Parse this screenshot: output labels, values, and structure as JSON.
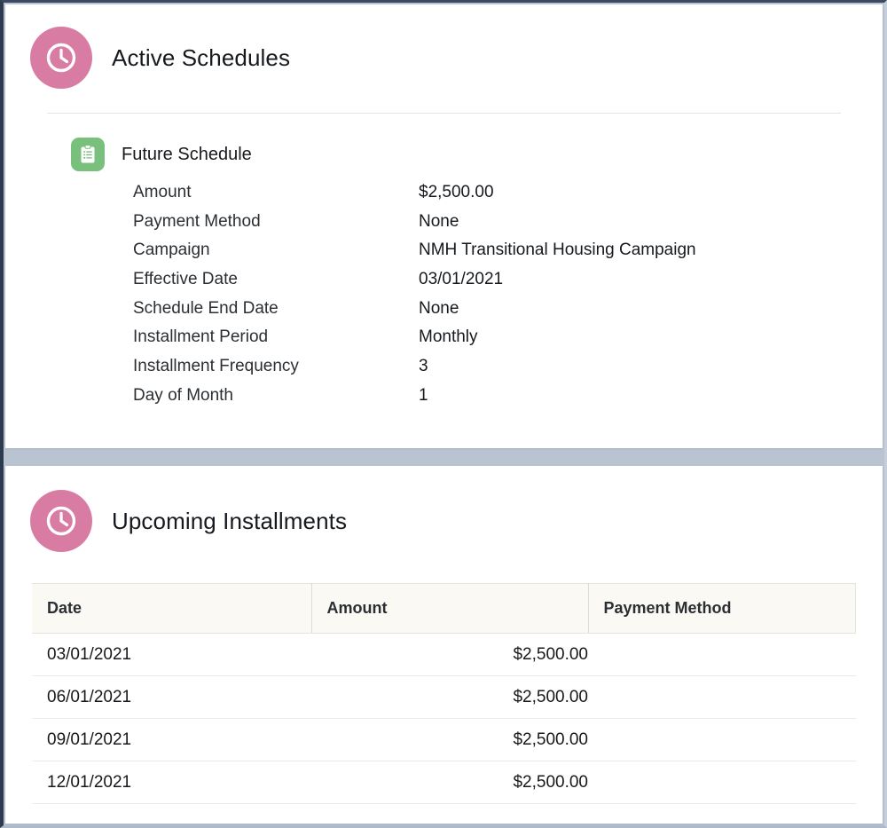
{
  "theme": {
    "accent_pink": "#d97ca4",
    "accent_green": "#78c07c",
    "gutter": "#b9c3d2",
    "table_header_bg": "#faf9f4"
  },
  "cards": {
    "active_schedules": {
      "title": "Active Schedules",
      "icon": "clock-icon",
      "schedule": {
        "name": "Future Schedule",
        "icon": "clipboard-icon",
        "fields": [
          {
            "label": "Amount",
            "value": "$2,500.00"
          },
          {
            "label": "Payment Method",
            "value": "None"
          },
          {
            "label": "Campaign",
            "value": "NMH Transitional Housing Campaign"
          },
          {
            "label": "Effective Date",
            "value": "03/01/2021"
          },
          {
            "label": "Schedule End Date",
            "value": "None"
          },
          {
            "label": "Installment Period",
            "value": "Monthly"
          },
          {
            "label": "Installment Frequency",
            "value": "3"
          },
          {
            "label": "Day of Month",
            "value": "1"
          }
        ]
      }
    },
    "upcoming_installments": {
      "title": "Upcoming Installments",
      "icon": "clock-icon",
      "table": {
        "columns": [
          "Date",
          "Amount",
          "Payment Method"
        ],
        "rows": [
          {
            "date": "03/01/2021",
            "amount": "$2,500.00",
            "payment_method": ""
          },
          {
            "date": "06/01/2021",
            "amount": "$2,500.00",
            "payment_method": ""
          },
          {
            "date": "09/01/2021",
            "amount": "$2,500.00",
            "payment_method": ""
          },
          {
            "date": "12/01/2021",
            "amount": "$2,500.00",
            "payment_method": ""
          }
        ]
      }
    }
  }
}
